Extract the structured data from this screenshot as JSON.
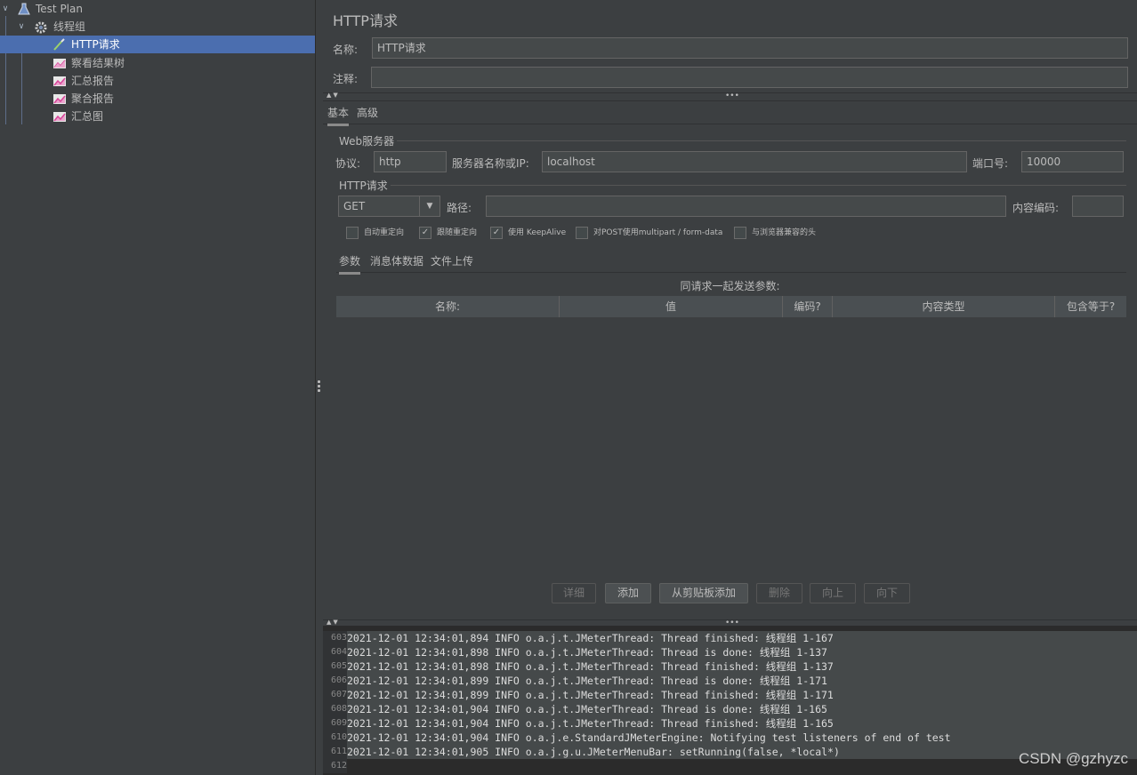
{
  "tree": {
    "items": [
      {
        "label": "Test Plan",
        "icon": "flask-icon",
        "expanded": true
      },
      {
        "label": "线程组",
        "icon": "gear-icon",
        "expanded": true
      },
      {
        "label": "HTTP请求",
        "icon": "pipette-icon",
        "selected": true
      },
      {
        "label": "察看结果树",
        "icon": "chart-listener-icon"
      },
      {
        "label": "汇总报告",
        "icon": "chart-listener-icon"
      },
      {
        "label": "聚合报告",
        "icon": "chart-listener-icon"
      },
      {
        "label": "汇总图",
        "icon": "chart-listener-icon"
      }
    ]
  },
  "panel": {
    "title": "HTTP请求",
    "name_label": "名称:",
    "name_value": "HTTP请求",
    "comment_label": "注释:",
    "comment_value": ""
  },
  "tabs": {
    "basic": "基本",
    "advanced": "高级"
  },
  "web_server": {
    "group_title": "Web服务器",
    "protocol_label": "协议:",
    "protocol_value": "http",
    "server_label": "服务器名称或IP:",
    "server_value": "localhost",
    "port_label": "端口号:",
    "port_value": "10000"
  },
  "http_request": {
    "group_title": "HTTP请求",
    "method_value": "GET",
    "path_label": "路径:",
    "path_value": "",
    "encoding_label": "内容编码:",
    "encoding_value": ""
  },
  "checkboxes": [
    {
      "label": "自动重定向",
      "checked": false
    },
    {
      "label": "跟随重定向",
      "checked": true
    },
    {
      "label": "使用 KeepAlive",
      "checked": true
    },
    {
      "label": "对POST使用multipart / form-data",
      "checked": false
    },
    {
      "label": "与浏览器兼容的头",
      "checked": false
    }
  ],
  "subtabs": {
    "params": "参数",
    "body": "消息体数据",
    "files": "文件上传"
  },
  "table": {
    "caption": "同请求一起发送参数:",
    "headers": [
      "名称:",
      "值",
      "编码?",
      "内容类型",
      "包含等于?"
    ]
  },
  "buttons": {
    "detail": "详细",
    "add": "添加",
    "add_clipboard": "从剪贴板添加",
    "delete": "删除",
    "up": "向上",
    "down": "向下"
  },
  "log": {
    "lines": [
      {
        "n": "603",
        "text": "2021-12-01 12:34:01,894 INFO o.a.j.t.JMeterThread: Thread finished: 线程组 1-167"
      },
      {
        "n": "604",
        "text": "2021-12-01 12:34:01,898 INFO o.a.j.t.JMeterThread: Thread is done: 线程组 1-137"
      },
      {
        "n": "605",
        "text": "2021-12-01 12:34:01,898 INFO o.a.j.t.JMeterThread: Thread finished: 线程组 1-137"
      },
      {
        "n": "606",
        "text": "2021-12-01 12:34:01,899 INFO o.a.j.t.JMeterThread: Thread is done: 线程组 1-171"
      },
      {
        "n": "607",
        "text": "2021-12-01 12:34:01,899 INFO o.a.j.t.JMeterThread: Thread finished: 线程组 1-171"
      },
      {
        "n": "608",
        "text": "2021-12-01 12:34:01,904 INFO o.a.j.t.JMeterThread: Thread is done: 线程组 1-165"
      },
      {
        "n": "609",
        "text": "2021-12-01 12:34:01,904 INFO o.a.j.t.JMeterThread: Thread finished: 线程组 1-165"
      },
      {
        "n": "610",
        "text": "2021-12-01 12:34:01,904 INFO o.a.j.e.StandardJMeterEngine: Notifying test listeners of end of test"
      },
      {
        "n": "611",
        "text": "2021-12-01 12:34:01,905 INFO o.a.j.g.u.JMeterMenuBar: setRunning(false, *local*)"
      },
      {
        "n": "612",
        "text": ""
      }
    ]
  },
  "watermark": "CSDN @gzhyzc",
  "colors": {
    "background": "#3c3f41",
    "selection": "#4b6eaf",
    "log_current_line": "#ffffcc"
  }
}
